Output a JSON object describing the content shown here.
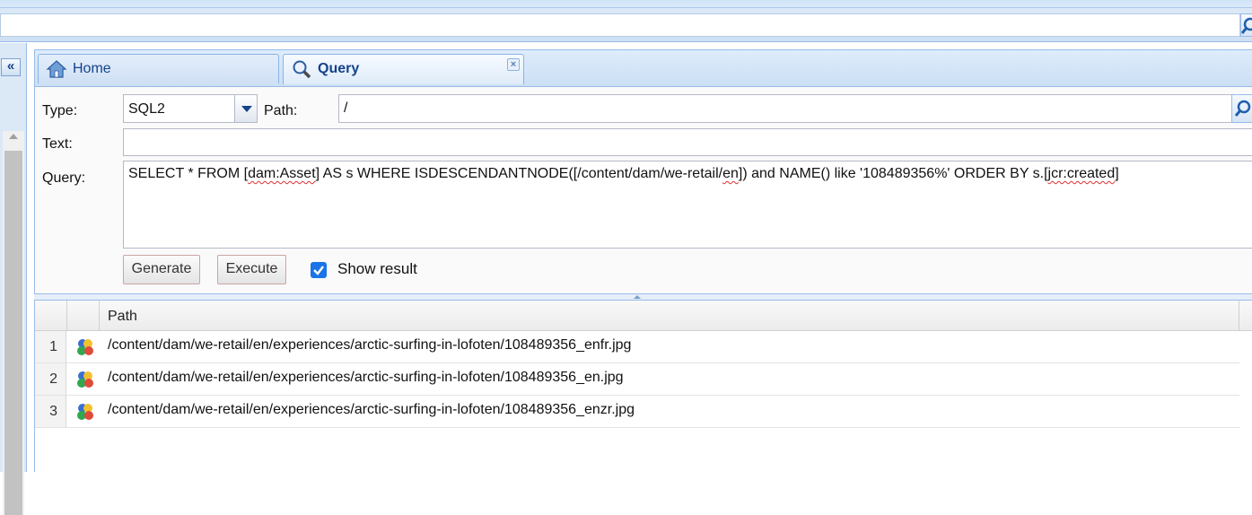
{
  "tabs": [
    {
      "label": "Home",
      "icon": "home-icon",
      "active": false
    },
    {
      "label": "Query",
      "icon": "magnifier-icon",
      "active": true
    }
  ],
  "form": {
    "type_label": "Type:",
    "type_value": "SQL2",
    "path_label": "Path:",
    "path_value": "/",
    "text_label": "Text:",
    "text_value": "",
    "query_label": "Query:",
    "query_parts": {
      "p1": "SELECT * FROM [",
      "p2": "dam:Asset",
      "p3": "] AS s WHERE ISDESCENDANTNODE([/content/dam/we-retail/",
      "p4": "en",
      "p5": "]) and NAME() like '108489356%' ORDER BY s.[",
      "p6": "jcr:created",
      "p7": "]"
    },
    "generate_label": "Generate",
    "execute_label": "Execute",
    "show_result_label": "Show result",
    "show_result_checked": true
  },
  "results": {
    "column_header": "Path",
    "rows": [
      {
        "num": "1",
        "path": "/content/dam/we-retail/en/experiences/arctic-surfing-in-lofoten/108489356_enfr.jpg"
      },
      {
        "num": "2",
        "path": "/content/dam/we-retail/en/experiences/arctic-surfing-in-lofoten/108489356_en.jpg"
      },
      {
        "num": "3",
        "path": "/content/dam/we-retail/en/experiences/arctic-surfing-in-lofoten/108489356_enzr.jpg"
      }
    ]
  },
  "colors": {
    "accent": "#15428b",
    "panel_border": "#99bbe8",
    "checkbox": "#1a73e8"
  }
}
